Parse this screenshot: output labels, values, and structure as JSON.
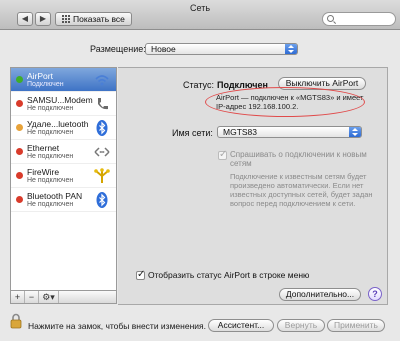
{
  "window": {
    "title": "Сеть"
  },
  "toolbar": {
    "show_all_label": "Показать все",
    "back": "◀",
    "forward": "▶"
  },
  "location": {
    "label": "Размещение:",
    "value": "Новое"
  },
  "services": [
    {
      "name": "AirPort",
      "status": "Подключен",
      "dot": "#3fae29",
      "icon": "wifi-icon"
    },
    {
      "name": "SAMSU...Modem",
      "status": "Не подключен",
      "dot": "#d93b2b",
      "icon": "phone-icon"
    },
    {
      "name": "Удале...luetooth",
      "status": "Не подключен",
      "dot": "#e8a33a",
      "icon": "bluetooth-icon"
    },
    {
      "name": "Ethernet",
      "status": "Не подключен",
      "dot": "#d93b2b",
      "icon": "ethernet-icon"
    },
    {
      "name": "FireWire",
      "status": "Не подключен",
      "dot": "#d93b2b",
      "icon": "firewire-icon"
    },
    {
      "name": "Bluetooth PAN",
      "status": "Не подключен",
      "dot": "#d93b2b",
      "icon": "bluetooth-icon"
    }
  ],
  "list_buttons": {
    "add": "+",
    "remove": "−",
    "action": "⚙▾"
  },
  "detail": {
    "status_label": "Статус:",
    "status_value": "Подключен",
    "toggle_label": "Выключить AirPort",
    "status_desc_line1": "AirPort — подключен к «MGTS83» и имеет",
    "status_desc_line2": "IP-адрес 192.168.100.2.",
    "network_label": "Имя сети:",
    "network_value": "MGTS83",
    "ask_label_line1": "Спрашивать о подключении к новым",
    "ask_label_line2": "сетям",
    "ask_desc": "Подключение к известным сетям будет произведено автоматически. Если нет известных доступных сетей, будет задан вопрос перед подключением к сети.",
    "menu_status_label": "Отобразить статус AirPort в строке меню",
    "advanced_label": "Дополнительно...",
    "help_label": "?"
  },
  "bottom": {
    "lock_text": "Нажмите на замок, чтобы внести изменения.",
    "assistant_label": "Ассистент...",
    "revert_label": "Вернуть",
    "apply_label": "Применить"
  },
  "colors": {
    "selection": "#3e73c6",
    "annotation": "#e04b4b",
    "accent": "#2e6bd4"
  }
}
